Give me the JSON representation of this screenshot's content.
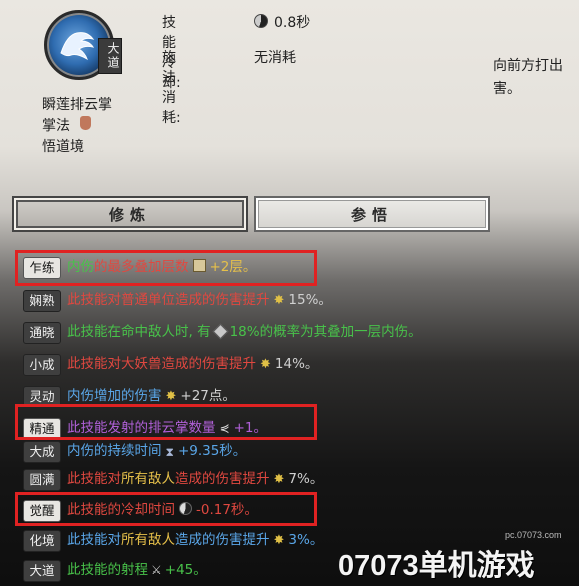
{
  "skill": {
    "icon": "palm-strike-icon",
    "badge": "大道",
    "name": "瞬莲排云掌",
    "type": "掌法",
    "realm": "悟道境",
    "cooldown_label": "技能冷却:",
    "cooldown_value": "0.8秒",
    "cost_label": "施法消耗:",
    "cost_value": "无消耗",
    "description": "向前方打出害。"
  },
  "tabs": {
    "cultivate": "修炼",
    "comprehend": "参悟"
  },
  "rows": [
    {
      "tag": "乍练",
      "parts": [
        "内伤",
        "的最多叠加层数",
        "+2层。"
      ]
    },
    {
      "tag": "娴熟",
      "parts": [
        "此技能对普通单位造成的伤害提升",
        "15%。"
      ]
    },
    {
      "tag": "通晓",
      "parts": [
        "此技能在命中敌人时, 有",
        "18%的概率为其叠加一层内伤。"
      ]
    },
    {
      "tag": "小成",
      "parts": [
        "此技能对大妖兽造成的伤害提升",
        "14%。"
      ]
    },
    {
      "tag": "灵动",
      "parts": [
        "内伤增加的伤害",
        "+27点。"
      ]
    },
    {
      "tag": "精通",
      "parts": [
        "此技能发射的排云掌数量",
        "+1。"
      ]
    },
    {
      "tag": "大成",
      "parts": [
        "内伤的持续时间",
        "+9.35秒。"
      ]
    },
    {
      "tag": "圆满",
      "parts": [
        "此技能对",
        "所有敌人",
        "造成的伤害提升",
        "7%。"
      ]
    },
    {
      "tag": "觉醒",
      "parts": [
        "此技能的冷却时间",
        "-0.17秒。"
      ]
    },
    {
      "tag": "化境",
      "parts": [
        "此技能对",
        "所有敌人",
        "造成的伤害提升",
        "3%。"
      ]
    },
    {
      "tag": "大道",
      "parts": [
        "此技能的射程",
        "+45。"
      ]
    }
  ],
  "watermark": {
    "url": "pc.07073.com",
    "brand": "07073单机游戏"
  },
  "colors": {
    "highlight": "#e02222",
    "green": "#48c24a",
    "red": "#e04840",
    "purple": "#b060d8",
    "blue": "#5aa6e8",
    "gold": "#e6c04a"
  }
}
